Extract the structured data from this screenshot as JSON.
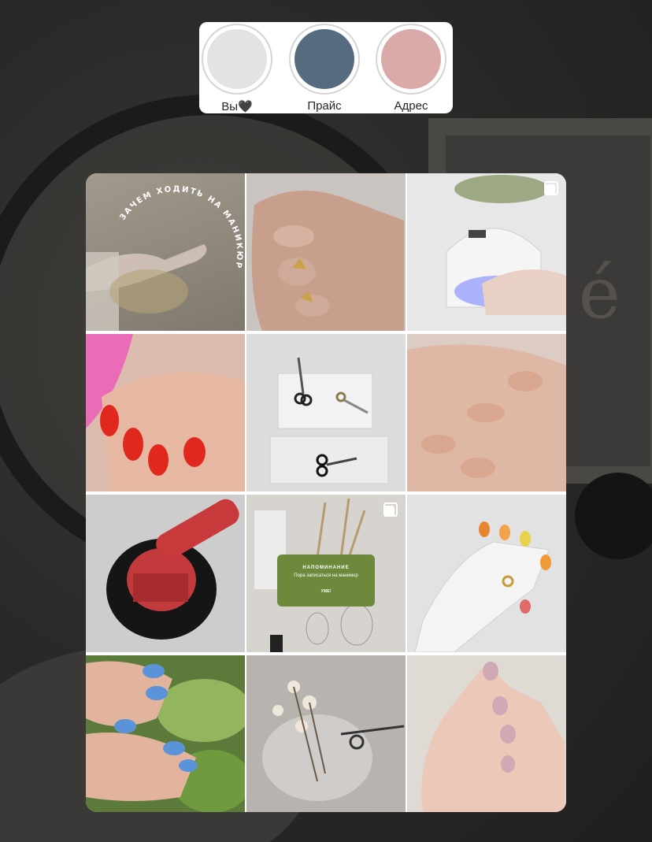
{
  "colors": {
    "highlight_1": "#e3e3e3",
    "highlight_2": "#566a80",
    "highlight_3": "#d9aaa8",
    "reminder_card": "#6d8a3c"
  },
  "highlights": [
    {
      "label": "Вы🖤"
    },
    {
      "label": "Прайс"
    },
    {
      "label": "Адрес"
    }
  ],
  "posts": {
    "p1": {
      "text": "ЗАЧЕМ ХОДИТЬ НА МАНИКЮРТ"
    },
    "p8": {
      "title": "НАПОМИНАНИЕ",
      "body": "Пора записаться на маникюр",
      "button": "УЖЕ!"
    }
  }
}
